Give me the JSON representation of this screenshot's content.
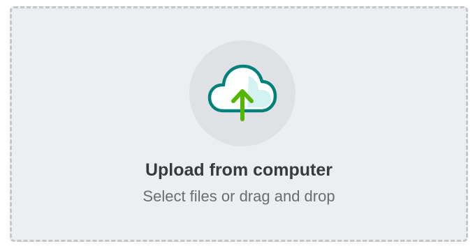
{
  "upload": {
    "title": "Upload from computer",
    "subtitle": "Select files or drag and drop",
    "icon": "cloud-upload-icon"
  },
  "colors": {
    "zone_background": "#eceef1",
    "zone_border": "#c4c6c9",
    "icon_circle": "#dfe1e4",
    "cloud_outline": "#00817a",
    "cloud_fill": "#d5f2f3",
    "arrow": "#53b700",
    "title_text": "#393a3d",
    "subtitle_text": "#6b6c72"
  }
}
